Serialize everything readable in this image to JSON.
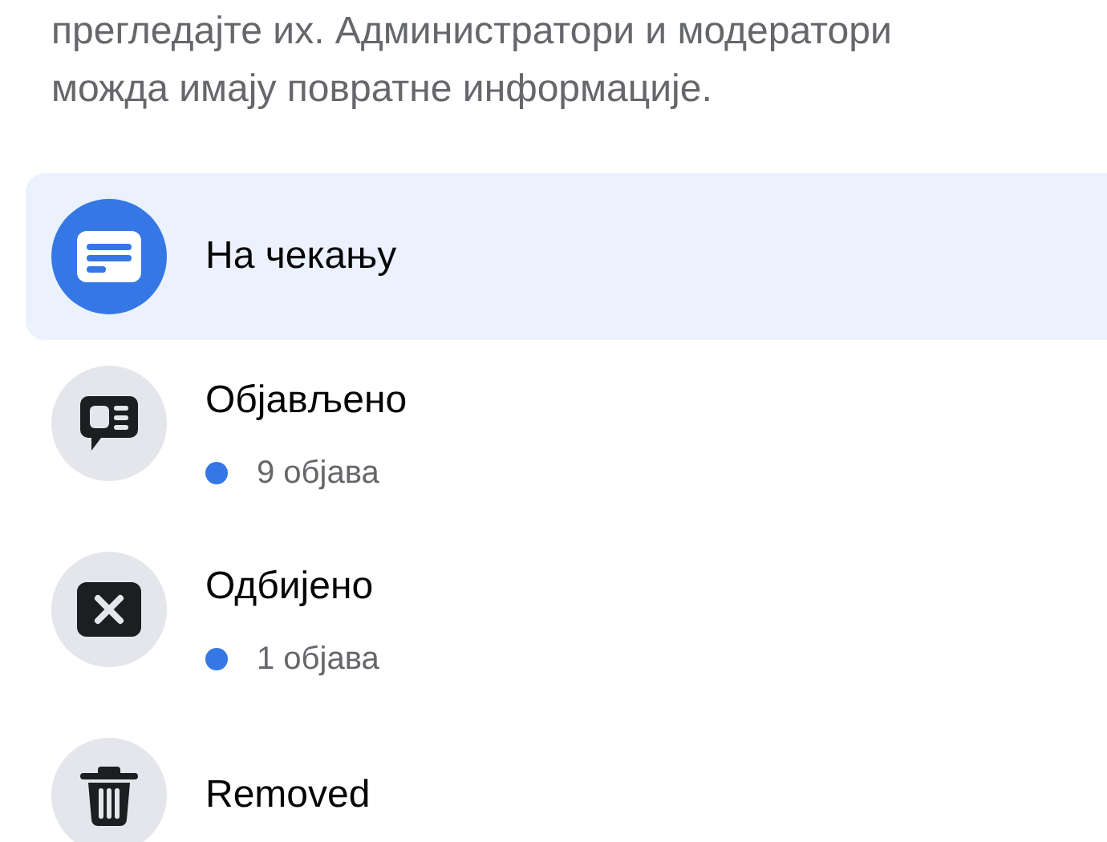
{
  "description": {
    "lines": [
      "прегледајте их. Администратори и модератори",
      "можда имају повратне информације."
    ]
  },
  "items": [
    {
      "kind": "pending",
      "title": "На чекању",
      "selected": true
    },
    {
      "kind": "published",
      "title": "Објављено",
      "selected": false,
      "count": "9 објава",
      "color": "#3578e5"
    },
    {
      "kind": "declined",
      "title": "Одбијено",
      "selected": false,
      "count": "1 објава",
      "color": "#3578e5"
    },
    {
      "kind": "removed",
      "title": "Removed",
      "selected": false
    }
  ]
}
